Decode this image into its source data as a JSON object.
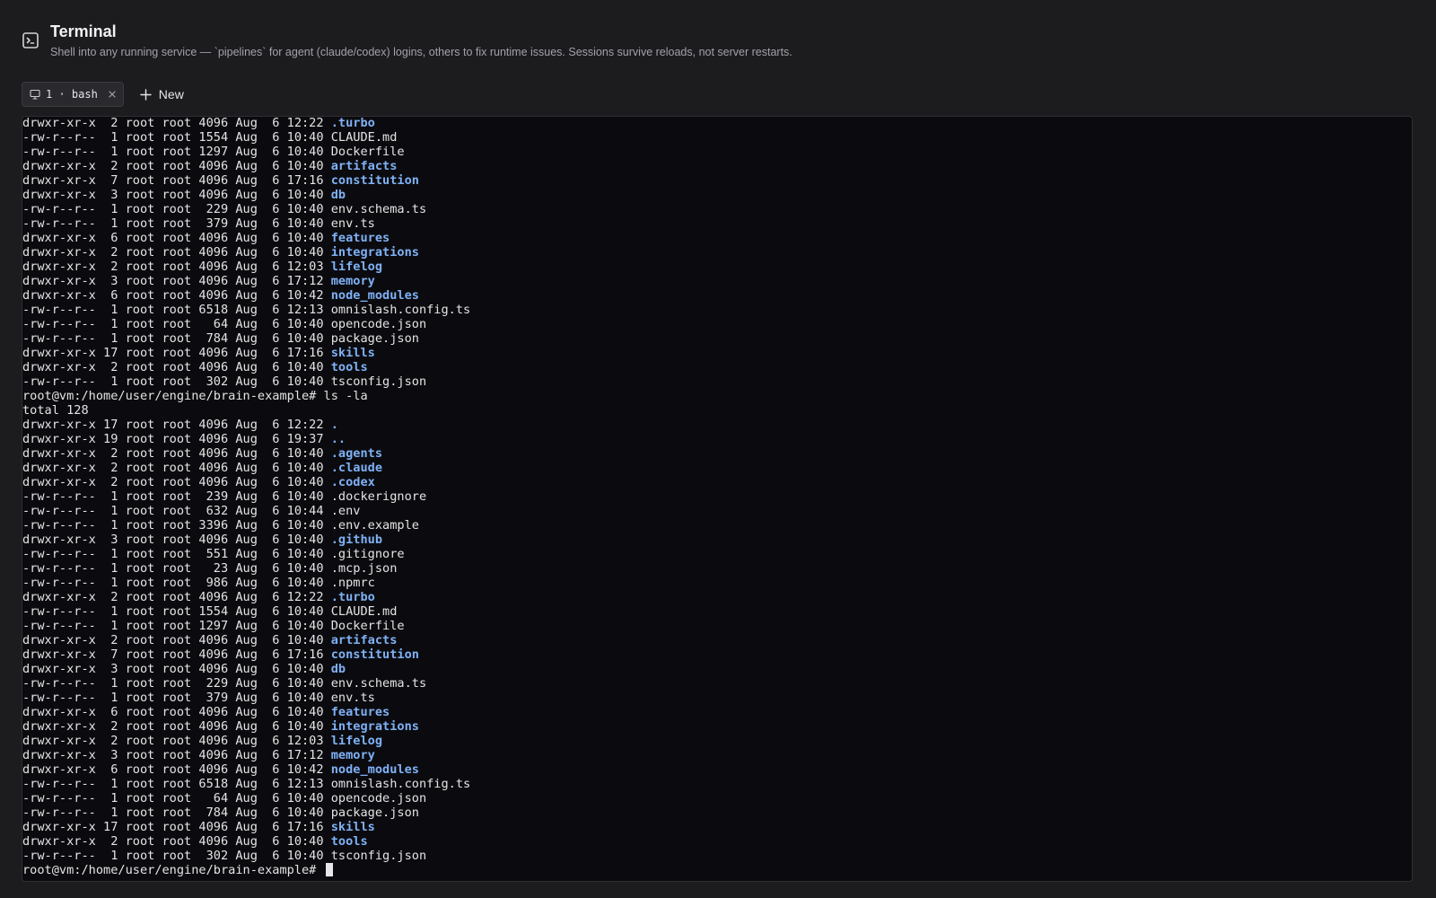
{
  "header": {
    "title": "Terminal",
    "subtitle": "Shell into any running service — `pipelines` for agent (claude/codex) logins, others to fix runtime issues. Sessions survive reloads, not server restarts.",
    "icon": "terminal-square-icon"
  },
  "tabs": [
    {
      "label": "1 · bash",
      "icon": "monitor-icon",
      "close_icon": "close-icon",
      "active": true
    }
  ],
  "new_button": {
    "label": "New",
    "icon": "plus-icon"
  },
  "terminal": {
    "colors": {
      "background": "#0b0b0f",
      "text": "#e4e4e4",
      "directory": "#7fb1f5"
    },
    "lines": [
      {
        "text": "drwxr-xr-x  2 root root 4096 Aug  6 12:22 ",
        "name": ".turbo",
        "dir": true
      },
      {
        "text": "-rw-r--r--  1 root root 1554 Aug  6 10:40 ",
        "name": "CLAUDE.md",
        "dir": false
      },
      {
        "text": "-rw-r--r--  1 root root 1297 Aug  6 10:40 ",
        "name": "Dockerfile",
        "dir": false
      },
      {
        "text": "drwxr-xr-x  2 root root 4096 Aug  6 10:40 ",
        "name": "artifacts",
        "dir": true
      },
      {
        "text": "drwxr-xr-x  7 root root 4096 Aug  6 17:16 ",
        "name": "constitution",
        "dir": true
      },
      {
        "text": "drwxr-xr-x  3 root root 4096 Aug  6 10:40 ",
        "name": "db",
        "dir": true
      },
      {
        "text": "-rw-r--r--  1 root root  229 Aug  6 10:40 ",
        "name": "env.schema.ts",
        "dir": false
      },
      {
        "text": "-rw-r--r--  1 root root  379 Aug  6 10:40 ",
        "name": "env.ts",
        "dir": false
      },
      {
        "text": "drwxr-xr-x  6 root root 4096 Aug  6 10:40 ",
        "name": "features",
        "dir": true
      },
      {
        "text": "drwxr-xr-x  2 root root 4096 Aug  6 10:40 ",
        "name": "integrations",
        "dir": true
      },
      {
        "text": "drwxr-xr-x  2 root root 4096 Aug  6 12:03 ",
        "name": "lifelog",
        "dir": true
      },
      {
        "text": "drwxr-xr-x  3 root root 4096 Aug  6 17:12 ",
        "name": "memory",
        "dir": true
      },
      {
        "text": "drwxr-xr-x  6 root root 4096 Aug  6 10:42 ",
        "name": "node_modules",
        "dir": true
      },
      {
        "text": "-rw-r--r--  1 root root 6518 Aug  6 12:13 ",
        "name": "omnislash.config.ts",
        "dir": false
      },
      {
        "text": "-rw-r--r--  1 root root   64 Aug  6 10:40 ",
        "name": "opencode.json",
        "dir": false
      },
      {
        "text": "-rw-r--r--  1 root root  784 Aug  6 10:40 ",
        "name": "package.json",
        "dir": false
      },
      {
        "text": "drwxr-xr-x 17 root root 4096 Aug  6 17:16 ",
        "name": "skills",
        "dir": true
      },
      {
        "text": "drwxr-xr-x  2 root root 4096 Aug  6 10:40 ",
        "name": "tools",
        "dir": true
      },
      {
        "text": "-rw-r--r--  1 root root  302 Aug  6 10:40 ",
        "name": "tsconfig.json",
        "dir": false
      },
      {
        "text": "root@vm:/home/user/engine/brain-example# ls -la",
        "name": "",
        "dir": false
      },
      {
        "text": "total 128",
        "name": "",
        "dir": false
      },
      {
        "text": "drwxr-xr-x 17 root root 4096 Aug  6 12:22 ",
        "name": ".",
        "dir": true
      },
      {
        "text": "drwxr-xr-x 19 root root 4096 Aug  6 19:37 ",
        "name": "..",
        "dir": true
      },
      {
        "text": "drwxr-xr-x  2 root root 4096 Aug  6 10:40 ",
        "name": ".agents",
        "dir": true
      },
      {
        "text": "drwxr-xr-x  2 root root 4096 Aug  6 10:40 ",
        "name": ".claude",
        "dir": true
      },
      {
        "text": "drwxr-xr-x  2 root root 4096 Aug  6 10:40 ",
        "name": ".codex",
        "dir": true
      },
      {
        "text": "-rw-r--r--  1 root root  239 Aug  6 10:40 ",
        "name": ".dockerignore",
        "dir": false
      },
      {
        "text": "-rw-r--r--  1 root root  632 Aug  6 10:44 ",
        "name": ".env",
        "dir": false
      },
      {
        "text": "-rw-r--r--  1 root root 3396 Aug  6 10:40 ",
        "name": ".env.example",
        "dir": false
      },
      {
        "text": "drwxr-xr-x  3 root root 4096 Aug  6 10:40 ",
        "name": ".github",
        "dir": true
      },
      {
        "text": "-rw-r--r--  1 root root  551 Aug  6 10:40 ",
        "name": ".gitignore",
        "dir": false
      },
      {
        "text": "-rw-r--r--  1 root root   23 Aug  6 10:40 ",
        "name": ".mcp.json",
        "dir": false
      },
      {
        "text": "-rw-r--r--  1 root root  986 Aug  6 10:40 ",
        "name": ".npmrc",
        "dir": false
      },
      {
        "text": "drwxr-xr-x  2 root root 4096 Aug  6 12:22 ",
        "name": ".turbo",
        "dir": true
      },
      {
        "text": "-rw-r--r--  1 root root 1554 Aug  6 10:40 ",
        "name": "CLAUDE.md",
        "dir": false
      },
      {
        "text": "-rw-r--r--  1 root root 1297 Aug  6 10:40 ",
        "name": "Dockerfile",
        "dir": false
      },
      {
        "text": "drwxr-xr-x  2 root root 4096 Aug  6 10:40 ",
        "name": "artifacts",
        "dir": true
      },
      {
        "text": "drwxr-xr-x  7 root root 4096 Aug  6 17:16 ",
        "name": "constitution",
        "dir": true
      },
      {
        "text": "drwxr-xr-x  3 root root 4096 Aug  6 10:40 ",
        "name": "db",
        "dir": true
      },
      {
        "text": "-rw-r--r--  1 root root  229 Aug  6 10:40 ",
        "name": "env.schema.ts",
        "dir": false
      },
      {
        "text": "-rw-r--r--  1 root root  379 Aug  6 10:40 ",
        "name": "env.ts",
        "dir": false
      },
      {
        "text": "drwxr-xr-x  6 root root 4096 Aug  6 10:40 ",
        "name": "features",
        "dir": true
      },
      {
        "text": "drwxr-xr-x  2 root root 4096 Aug  6 10:40 ",
        "name": "integrations",
        "dir": true
      },
      {
        "text": "drwxr-xr-x  2 root root 4096 Aug  6 12:03 ",
        "name": "lifelog",
        "dir": true
      },
      {
        "text": "drwxr-xr-x  3 root root 4096 Aug  6 17:12 ",
        "name": "memory",
        "dir": true
      },
      {
        "text": "drwxr-xr-x  6 root root 4096 Aug  6 10:42 ",
        "name": "node_modules",
        "dir": true
      },
      {
        "text": "-rw-r--r--  1 root root 6518 Aug  6 12:13 ",
        "name": "omnislash.config.ts",
        "dir": false
      },
      {
        "text": "-rw-r--r--  1 root root   64 Aug  6 10:40 ",
        "name": "opencode.json",
        "dir": false
      },
      {
        "text": "-rw-r--r--  1 root root  784 Aug  6 10:40 ",
        "name": "package.json",
        "dir": false
      },
      {
        "text": "drwxr-xr-x 17 root root 4096 Aug  6 17:16 ",
        "name": "skills",
        "dir": true
      },
      {
        "text": "drwxr-xr-x  2 root root 4096 Aug  6 10:40 ",
        "name": "tools",
        "dir": true
      },
      {
        "text": "-rw-r--r--  1 root root  302 Aug  6 10:40 ",
        "name": "tsconfig.json",
        "dir": false
      }
    ],
    "prompt": "root@vm:/home/user/engine/brain-example# "
  }
}
